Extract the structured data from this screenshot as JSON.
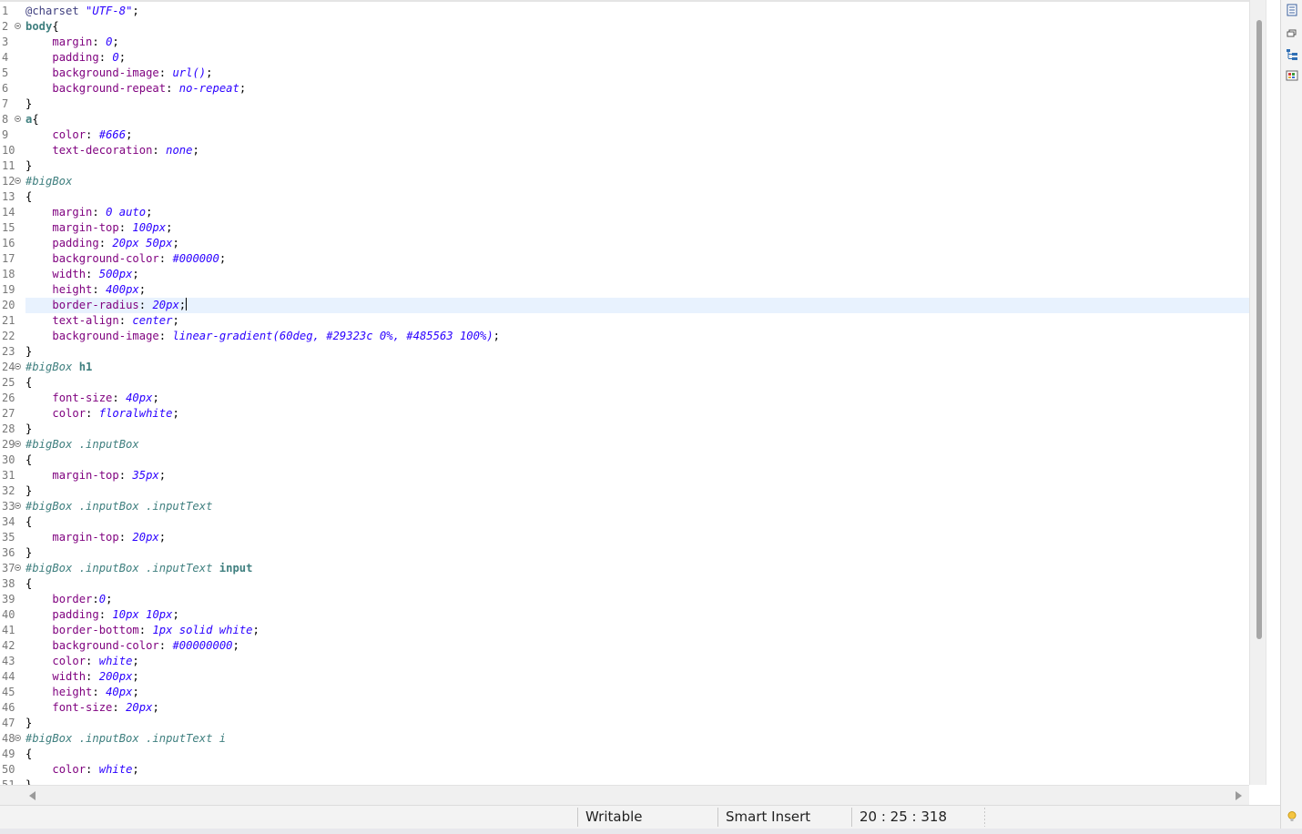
{
  "editor": {
    "current_line": 20,
    "lines": [
      {
        "n": "1",
        "fold": false,
        "tokens": [
          [
            "at",
            "@charset "
          ],
          [
            "str",
            "\"UTF-8\""
          ],
          [
            "p",
            ";"
          ]
        ]
      },
      {
        "n": "2",
        "fold": true,
        "tokens": [
          [
            "el",
            "body"
          ],
          [
            "p",
            "{"
          ]
        ]
      },
      {
        "n": "3",
        "fold": false,
        "tokens": [
          [
            "p",
            "    "
          ],
          [
            "prop",
            "margin"
          ],
          [
            "p",
            ": "
          ],
          [
            "val",
            "0"
          ],
          [
            "p",
            ";"
          ]
        ]
      },
      {
        "n": "4",
        "fold": false,
        "tokens": [
          [
            "p",
            "    "
          ],
          [
            "prop",
            "padding"
          ],
          [
            "p",
            ": "
          ],
          [
            "val",
            "0"
          ],
          [
            "p",
            ";"
          ]
        ]
      },
      {
        "n": "5",
        "fold": false,
        "tokens": [
          [
            "p",
            "    "
          ],
          [
            "prop",
            "background-image"
          ],
          [
            "p",
            ": "
          ],
          [
            "val",
            "url()"
          ],
          [
            "p",
            ";"
          ]
        ]
      },
      {
        "n": "6",
        "fold": false,
        "tokens": [
          [
            "p",
            "    "
          ],
          [
            "prop",
            "background-repeat"
          ],
          [
            "p",
            ": "
          ],
          [
            "val",
            "no-repeat"
          ],
          [
            "p",
            ";"
          ]
        ]
      },
      {
        "n": "7",
        "fold": false,
        "tokens": [
          [
            "p",
            "}"
          ]
        ]
      },
      {
        "n": "8",
        "fold": true,
        "tokens": [
          [
            "el",
            "a"
          ],
          [
            "p",
            "{"
          ]
        ]
      },
      {
        "n": "9",
        "fold": false,
        "tokens": [
          [
            "p",
            "    "
          ],
          [
            "prop",
            "color"
          ],
          [
            "p",
            ": "
          ],
          [
            "val",
            "#666"
          ],
          [
            "p",
            ";"
          ]
        ]
      },
      {
        "n": "10",
        "fold": false,
        "tokens": [
          [
            "p",
            "    "
          ],
          [
            "prop",
            "text-decoration"
          ],
          [
            "p",
            ": "
          ],
          [
            "val",
            "none"
          ],
          [
            "p",
            ";"
          ]
        ]
      },
      {
        "n": "11",
        "fold": false,
        "tokens": [
          [
            "p",
            "}"
          ]
        ]
      },
      {
        "n": "12",
        "fold": true,
        "tokens": [
          [
            "id",
            "#bigBox"
          ]
        ]
      },
      {
        "n": "13",
        "fold": false,
        "tokens": [
          [
            "p",
            "{"
          ]
        ]
      },
      {
        "n": "14",
        "fold": false,
        "tokens": [
          [
            "p",
            "    "
          ],
          [
            "prop",
            "margin"
          ],
          [
            "p",
            ": "
          ],
          [
            "val",
            "0 auto"
          ],
          [
            "p",
            ";"
          ]
        ]
      },
      {
        "n": "15",
        "fold": false,
        "tokens": [
          [
            "p",
            "    "
          ],
          [
            "prop",
            "margin-top"
          ],
          [
            "p",
            ": "
          ],
          [
            "val",
            "100px"
          ],
          [
            "p",
            ";"
          ]
        ]
      },
      {
        "n": "16",
        "fold": false,
        "tokens": [
          [
            "p",
            "    "
          ],
          [
            "prop",
            "padding"
          ],
          [
            "p",
            ": "
          ],
          [
            "val",
            "20px 50px"
          ],
          [
            "p",
            ";"
          ]
        ]
      },
      {
        "n": "17",
        "fold": false,
        "tokens": [
          [
            "p",
            "    "
          ],
          [
            "prop",
            "background-color"
          ],
          [
            "p",
            ": "
          ],
          [
            "val",
            "#000000"
          ],
          [
            "p",
            ";"
          ]
        ]
      },
      {
        "n": "18",
        "fold": false,
        "tokens": [
          [
            "p",
            "    "
          ],
          [
            "prop",
            "width"
          ],
          [
            "p",
            ": "
          ],
          [
            "val",
            "500px"
          ],
          [
            "p",
            ";"
          ]
        ]
      },
      {
        "n": "19",
        "fold": false,
        "tokens": [
          [
            "p",
            "    "
          ],
          [
            "prop",
            "height"
          ],
          [
            "p",
            ": "
          ],
          [
            "val",
            "400px"
          ],
          [
            "p",
            ";"
          ]
        ]
      },
      {
        "n": "20",
        "fold": false,
        "caret": true,
        "tokens": [
          [
            "p",
            "    "
          ],
          [
            "prop",
            "border-radius"
          ],
          [
            "p",
            ": "
          ],
          [
            "val",
            "20px"
          ],
          [
            "p",
            ";"
          ]
        ]
      },
      {
        "n": "21",
        "fold": false,
        "tokens": [
          [
            "p",
            "    "
          ],
          [
            "prop",
            "text-align"
          ],
          [
            "p",
            ": "
          ],
          [
            "val",
            "center"
          ],
          [
            "p",
            ";"
          ]
        ]
      },
      {
        "n": "22",
        "fold": false,
        "tokens": [
          [
            "p",
            "    "
          ],
          [
            "prop",
            "background-image"
          ],
          [
            "p",
            ": "
          ],
          [
            "val",
            "linear-gradient(60deg, #29323c 0%, #485563 100%)"
          ],
          [
            "p",
            ";"
          ]
        ]
      },
      {
        "n": "23",
        "fold": false,
        "tokens": [
          [
            "p",
            "}"
          ]
        ]
      },
      {
        "n": "24",
        "fold": true,
        "tokens": [
          [
            "id",
            "#bigBox "
          ],
          [
            "el",
            "h1"
          ]
        ]
      },
      {
        "n": "25",
        "fold": false,
        "tokens": [
          [
            "p",
            "{"
          ]
        ]
      },
      {
        "n": "26",
        "fold": false,
        "tokens": [
          [
            "p",
            "    "
          ],
          [
            "prop",
            "font-size"
          ],
          [
            "p",
            ": "
          ],
          [
            "val",
            "40px"
          ],
          [
            "p",
            ";"
          ]
        ]
      },
      {
        "n": "27",
        "fold": false,
        "tokens": [
          [
            "p",
            "    "
          ],
          [
            "prop",
            "color"
          ],
          [
            "p",
            ": "
          ],
          [
            "val",
            "floralwhite"
          ],
          [
            "p",
            ";"
          ]
        ]
      },
      {
        "n": "28",
        "fold": false,
        "tokens": [
          [
            "p",
            "}"
          ]
        ]
      },
      {
        "n": "29",
        "fold": true,
        "tokens": [
          [
            "id",
            "#bigBox .inputBox"
          ]
        ]
      },
      {
        "n": "30",
        "fold": false,
        "tokens": [
          [
            "p",
            "{"
          ]
        ]
      },
      {
        "n": "31",
        "fold": false,
        "tokens": [
          [
            "p",
            "    "
          ],
          [
            "prop",
            "margin-top"
          ],
          [
            "p",
            ": "
          ],
          [
            "val",
            "35px"
          ],
          [
            "p",
            ";"
          ]
        ]
      },
      {
        "n": "32",
        "fold": false,
        "tokens": [
          [
            "p",
            "}"
          ]
        ]
      },
      {
        "n": "33",
        "fold": true,
        "tokens": [
          [
            "id",
            "#bigBox .inputBox .inputText"
          ]
        ]
      },
      {
        "n": "34",
        "fold": false,
        "tokens": [
          [
            "p",
            "{"
          ]
        ]
      },
      {
        "n": "35",
        "fold": false,
        "tokens": [
          [
            "p",
            "    "
          ],
          [
            "prop",
            "margin-top"
          ],
          [
            "p",
            ": "
          ],
          [
            "val",
            "20px"
          ],
          [
            "p",
            ";"
          ]
        ]
      },
      {
        "n": "36",
        "fold": false,
        "tokens": [
          [
            "p",
            "}"
          ]
        ]
      },
      {
        "n": "37",
        "fold": true,
        "tokens": [
          [
            "id",
            "#bigBox .inputBox .inputText "
          ],
          [
            "el",
            "input"
          ]
        ]
      },
      {
        "n": "38",
        "fold": false,
        "tokens": [
          [
            "p",
            "{"
          ]
        ]
      },
      {
        "n": "39",
        "fold": false,
        "tokens": [
          [
            "p",
            "    "
          ],
          [
            "prop",
            "border"
          ],
          [
            "p",
            ":"
          ],
          [
            "val",
            "0"
          ],
          [
            "p",
            ";"
          ]
        ]
      },
      {
        "n": "40",
        "fold": false,
        "tokens": [
          [
            "p",
            "    "
          ],
          [
            "prop",
            "padding"
          ],
          [
            "p",
            ": "
          ],
          [
            "val",
            "10px 10px"
          ],
          [
            "p",
            ";"
          ]
        ]
      },
      {
        "n": "41",
        "fold": false,
        "tokens": [
          [
            "p",
            "    "
          ],
          [
            "prop",
            "border-bottom"
          ],
          [
            "p",
            ": "
          ],
          [
            "val",
            "1px solid white"
          ],
          [
            "p",
            ";"
          ]
        ]
      },
      {
        "n": "42",
        "fold": false,
        "tokens": [
          [
            "p",
            "    "
          ],
          [
            "prop",
            "background-color"
          ],
          [
            "p",
            ": "
          ],
          [
            "val",
            "#00000000"
          ],
          [
            "p",
            ";"
          ]
        ]
      },
      {
        "n": "43",
        "fold": false,
        "tokens": [
          [
            "p",
            "    "
          ],
          [
            "prop",
            "color"
          ],
          [
            "p",
            ": "
          ],
          [
            "val",
            "white"
          ],
          [
            "p",
            ";"
          ]
        ]
      },
      {
        "n": "44",
        "fold": false,
        "tokens": [
          [
            "p",
            "    "
          ],
          [
            "prop",
            "width"
          ],
          [
            "p",
            ": "
          ],
          [
            "val",
            "200px"
          ],
          [
            "p",
            ";"
          ]
        ]
      },
      {
        "n": "45",
        "fold": false,
        "tokens": [
          [
            "p",
            "    "
          ],
          [
            "prop",
            "height"
          ],
          [
            "p",
            ": "
          ],
          [
            "val",
            "40px"
          ],
          [
            "p",
            ";"
          ]
        ]
      },
      {
        "n": "46",
        "fold": false,
        "tokens": [
          [
            "p",
            "    "
          ],
          [
            "prop",
            "font-size"
          ],
          [
            "p",
            ": "
          ],
          [
            "val",
            "20px"
          ],
          [
            "p",
            ";"
          ]
        ]
      },
      {
        "n": "47",
        "fold": false,
        "tokens": [
          [
            "p",
            "}"
          ]
        ]
      },
      {
        "n": "48",
        "fold": true,
        "tokens": [
          [
            "id",
            "#bigBox .inputBox .inputText i"
          ]
        ]
      },
      {
        "n": "49",
        "fold": false,
        "tokens": [
          [
            "p",
            "{"
          ]
        ]
      },
      {
        "n": "50",
        "fold": false,
        "tokens": [
          [
            "p",
            "    "
          ],
          [
            "prop",
            "color"
          ],
          [
            "p",
            ": "
          ],
          [
            "val",
            "white"
          ],
          [
            "p",
            ";"
          ]
        ]
      },
      {
        "n": "51",
        "fold": false,
        "tokens": [
          [
            "p",
            "}"
          ]
        ]
      }
    ]
  },
  "statusbar": {
    "writable": "Writable",
    "insert_mode": "Smart Insert",
    "position": "20 : 25 : 318"
  },
  "side_icons": [
    "outline-view-icon",
    "restore-icon",
    "hierarchy-icon",
    "palette-icon",
    "lightbulb-icon"
  ]
}
